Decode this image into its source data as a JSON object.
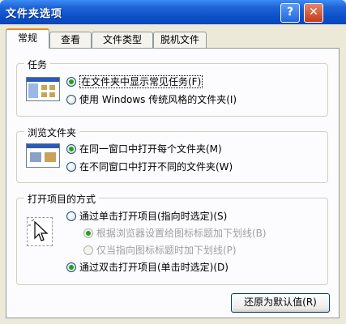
{
  "window": {
    "title": "文件夹选项",
    "help_glyph": "?",
    "close_glyph": "✕"
  },
  "tabs": [
    "常规",
    "查看",
    "文件类型",
    "脱机文件"
  ],
  "groups": {
    "tasks": {
      "label": "任务",
      "options": [
        "在文件夹中显示常见任务(F)",
        "使用 Windows 传统风格的文件夹(I)"
      ]
    },
    "browse": {
      "label": "浏览文件夹",
      "options": [
        "在同一窗口中打开每个文件夹(M)",
        "在不同窗口中打开不同的文件夹(W)"
      ]
    },
    "click": {
      "label": "打开项目的方式",
      "options": [
        "通过单击打开项目(指向时选定)(S)",
        "根据浏览器设置给图标标题加下划线(B)",
        "仅当指向图标标题时加下划线(P)",
        "通过双击打开项目(单击时选定)(D)"
      ]
    }
  },
  "restore_button": "还原为默认值(R)",
  "colors": {
    "title_bar": "#0b50c8",
    "panel_bg": "#fcfcfe",
    "dialog_bg": "#ece9d8"
  }
}
